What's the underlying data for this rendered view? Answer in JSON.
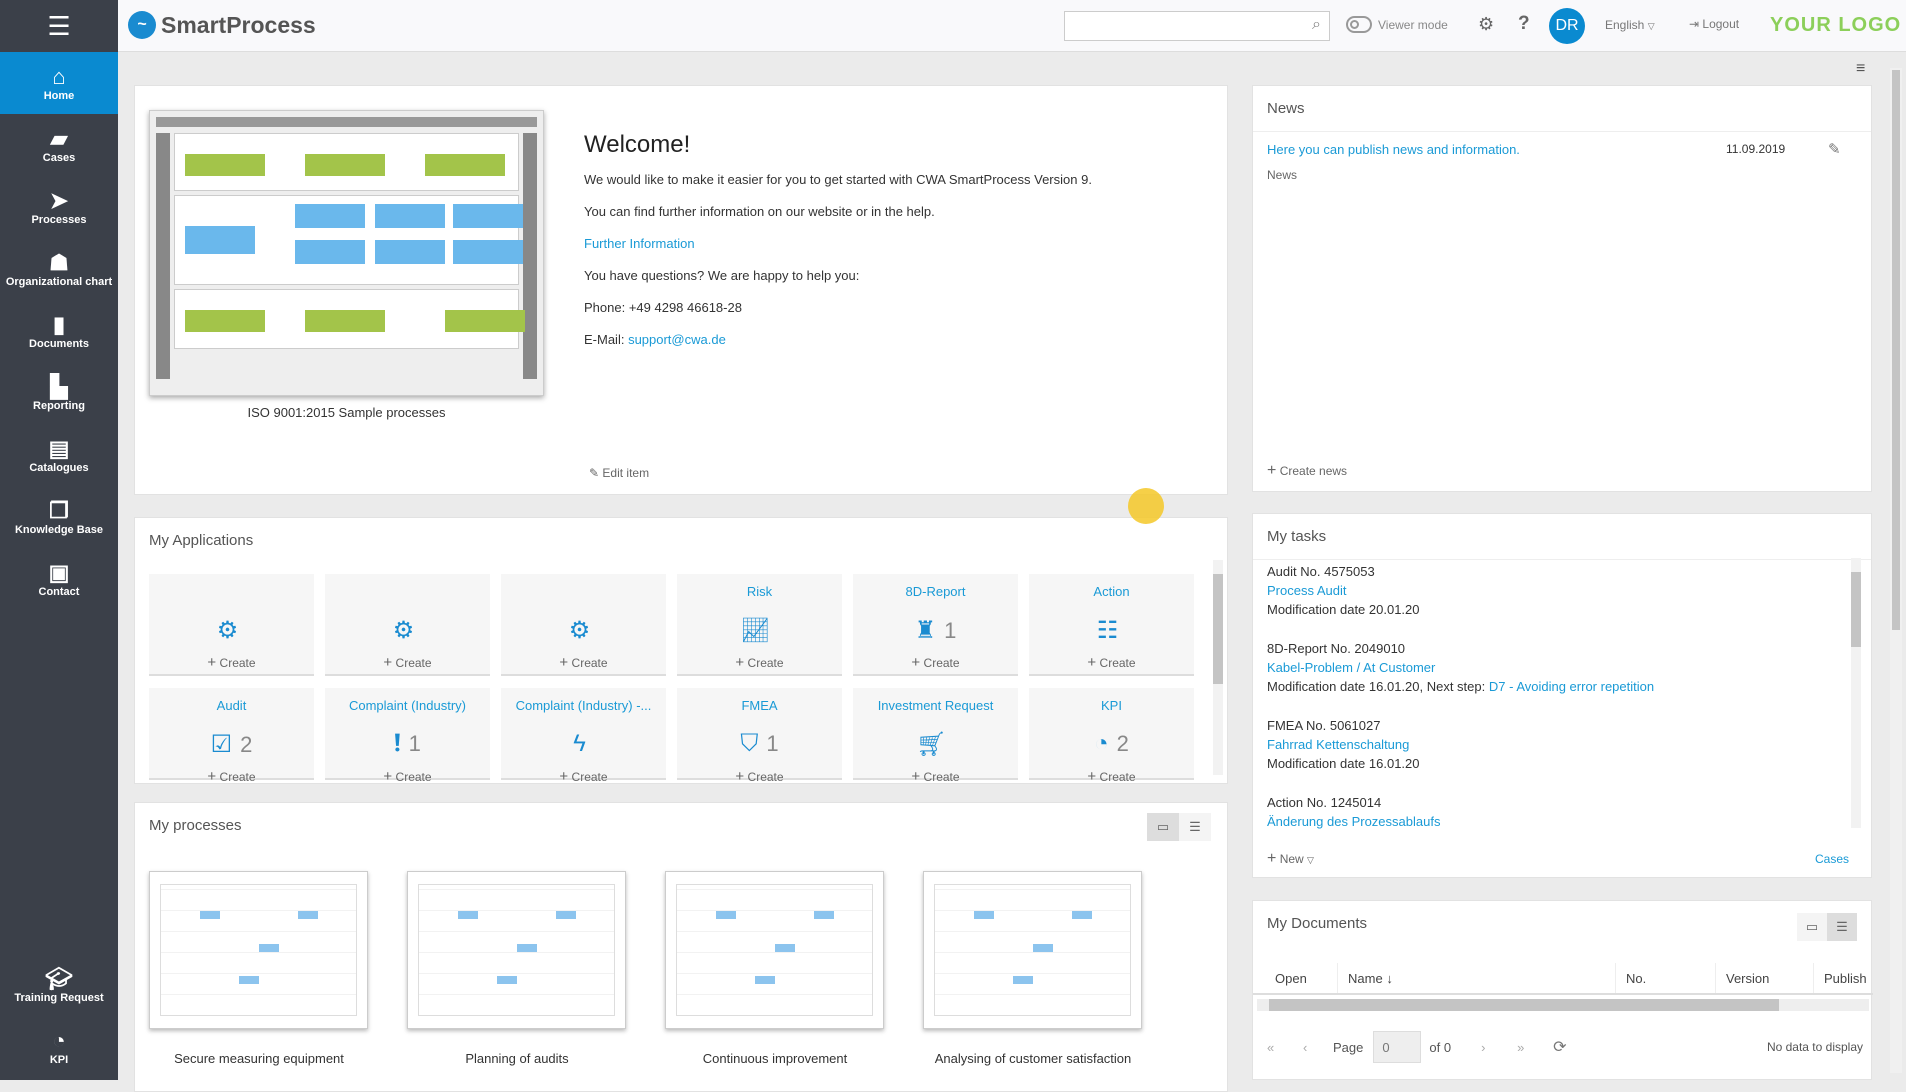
{
  "header": {
    "app_name": "SmartProcess",
    "search_placeholder": "",
    "viewer_mode": "Viewer mode",
    "avatar": "DR",
    "language": "English",
    "logout": "Logout",
    "logo": "YOUR LOGO"
  },
  "sidebar": {
    "items": [
      {
        "label": "Home",
        "icon": "home-icon"
      },
      {
        "label": "Cases",
        "icon": "folder-icon"
      },
      {
        "label": "Processes",
        "icon": "process-icon"
      },
      {
        "label": "Organizational chart",
        "icon": "org-chart-icon"
      },
      {
        "label": "Documents",
        "icon": "document-icon"
      },
      {
        "label": "Reporting",
        "icon": "chart-icon"
      },
      {
        "label": "Catalogues",
        "icon": "catalogue-icon"
      },
      {
        "label": "Knowledge Base",
        "icon": "copy-icon"
      },
      {
        "label": "Contact",
        "icon": "contact-icon"
      }
    ],
    "bottom": [
      {
        "label": "Training Request",
        "icon": "graduation-cap-icon"
      },
      {
        "label": "KPI",
        "icon": "gauge-icon"
      }
    ]
  },
  "welcome": {
    "image_caption": "ISO 9001:2015 Sample processes",
    "title": "Welcome!",
    "line1": "We would like to make it easier for you to get started with CWA SmartProcess Version 9.",
    "line2": "You can find further information on our website or in the help.",
    "link": "Further Information",
    "line3": "You have questions? We are happy to help you:",
    "phone": "Phone: +49 4298 46618-28",
    "email_label": "E-Mail: ",
    "email": "support@cwa.de",
    "edit": "Edit item"
  },
  "news": {
    "title": "News",
    "items": [
      {
        "text": "Here you can publish news and information.",
        "date": "11.09.2019",
        "category": "News"
      }
    ],
    "create": "Create news"
  },
  "applications": {
    "title": "My Applications",
    "create": "Create",
    "tiles": [
      {
        "title": "",
        "icon": "gears-icon",
        "count": ""
      },
      {
        "title": "",
        "icon": "gears-icon",
        "count": ""
      },
      {
        "title": "",
        "icon": "gears-icon",
        "count": ""
      },
      {
        "title": "Risk",
        "icon": "trend-chart-icon",
        "count": ""
      },
      {
        "title": "8D-Report",
        "icon": "binoculars-icon",
        "count": "1"
      },
      {
        "title": "Action",
        "icon": "checklist-icon",
        "count": ""
      },
      {
        "title": "Audit",
        "icon": "checkbox-icon",
        "count": "2"
      },
      {
        "title": "Complaint (Industry)",
        "icon": "exclamation-icon",
        "count": "1"
      },
      {
        "title": "Complaint (Industry) -...",
        "icon": "lightning-icon",
        "count": ""
      },
      {
        "title": "FMEA",
        "icon": "shield-icon",
        "count": "1"
      },
      {
        "title": "Investment Request",
        "icon": "cart-icon",
        "count": ""
      },
      {
        "title": "KPI",
        "icon": "gauge-icon",
        "count": "2"
      }
    ]
  },
  "tasks": {
    "title": "My tasks",
    "items": [
      {
        "head": "Audit No. 4575053",
        "link": "Process Audit",
        "meta": "Modification date 20.01.20",
        "step_label": "",
        "step": ""
      },
      {
        "head": "8D-Report No. 2049010",
        "link": "Kabel-Problem / At Customer",
        "meta": "Modification date 16.01.20, Next step: ",
        "step": "D7 - Avoiding error repetition"
      },
      {
        "head": "FMEA No. 5061027",
        "link": "Fahrrad Kettenschaltung",
        "meta": "Modification date 16.01.20",
        "step": ""
      },
      {
        "head": "Action No. 1245014",
        "link": "Änderung des Prozessablaufs",
        "meta": "",
        "step": ""
      }
    ],
    "new": "New",
    "cases": "Cases"
  },
  "processes": {
    "title": "My processes",
    "items": [
      "Secure measuring equipment",
      "Planning of audits",
      "Continuous improvement",
      "Analysing of customer satisfaction"
    ]
  },
  "documents": {
    "title": "My Documents",
    "columns": [
      "Open",
      "Name",
      "No.",
      "Version",
      "Publish"
    ],
    "page_label": "Page",
    "page": "0",
    "of": "of 0",
    "empty": "No data to display"
  }
}
